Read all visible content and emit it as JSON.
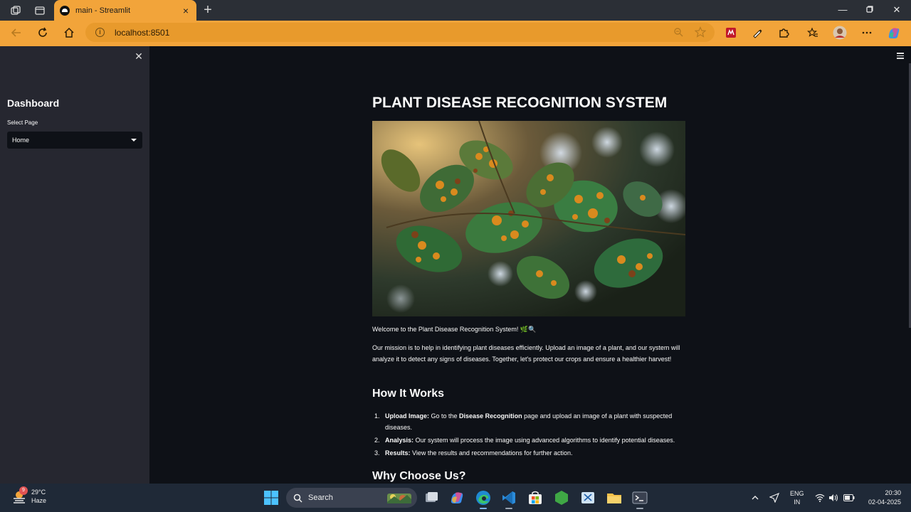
{
  "browser": {
    "tab_title": "main - Streamlit",
    "url": "localhost:8501"
  },
  "sidebar": {
    "title": "Dashboard",
    "select_label": "Select Page",
    "select_value": "Home"
  },
  "main": {
    "title": "PLANT DISEASE RECOGNITION SYSTEM",
    "welcome": "Welcome to the Plant Disease Recognition System! 🌿🔍",
    "mission": "Our mission is to help in identifying plant diseases efficiently. Upload an image of a plant, and our system will analyze it to detect any signs of diseases. Together, let's protect our crops and ensure a healthier harvest!",
    "how_heading": "How It Works",
    "steps": [
      {
        "num": "1.",
        "label": "Upload Image:",
        "pre": " Go to the ",
        "bold2": "Disease Recognition",
        "post": " page and upload an image of a plant with suspected diseases."
      },
      {
        "num": "2.",
        "label": "Analysis:",
        "text": " Our system will process the image using advanced algorithms to identify potential diseases."
      },
      {
        "num": "3.",
        "label": "Results:",
        "text": " View the results and recommendations for further action."
      }
    ],
    "why_heading": "Why Choose Us?"
  },
  "taskbar": {
    "weather_temp": "29°C",
    "weather_desc": "Haze",
    "weather_badge": "9",
    "search_label": "Search",
    "lang_line1": "ENG",
    "lang_line2": "IN",
    "time": "20:30",
    "date": "02-04-2025"
  },
  "colors": {
    "accent": "#f2a43a",
    "sidebar_bg": "#262730",
    "main_bg": "#0e1117"
  }
}
